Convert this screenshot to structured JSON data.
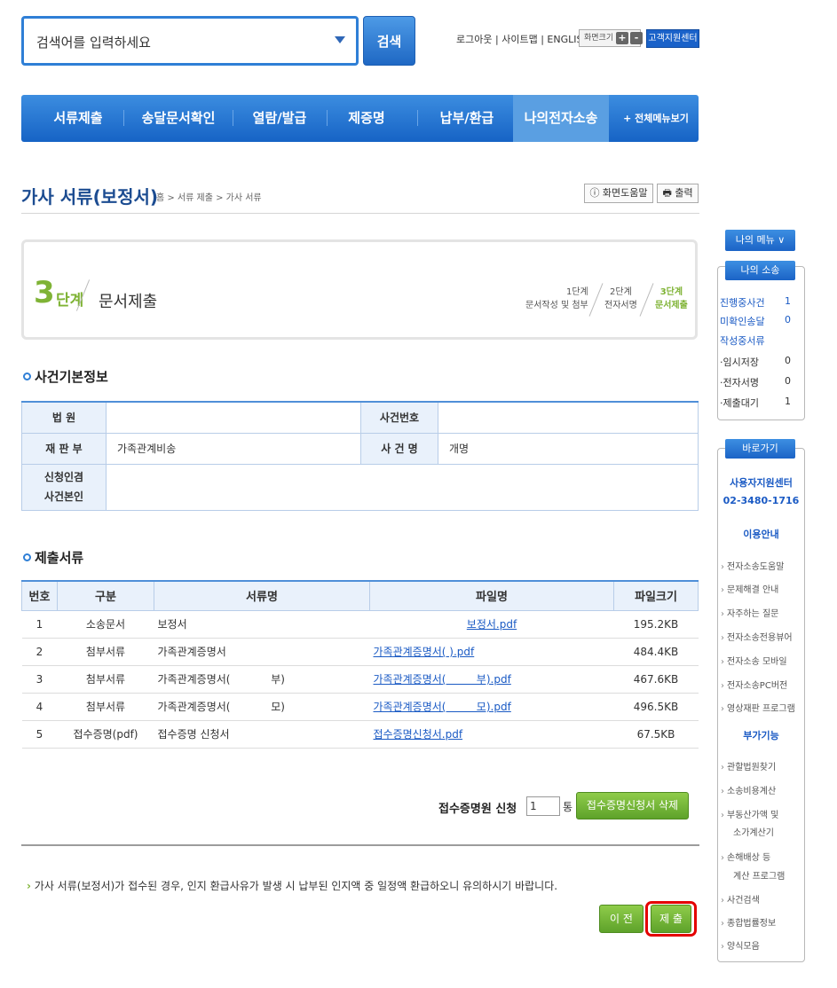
{
  "search": {
    "placeholder": "검색어를 입력하세요",
    "button": "검색"
  },
  "util": {
    "logout": "로그아웃",
    "sitemap": "사이트맵",
    "english": "ENGLISH",
    "fontsize": "화면크기",
    "plus": "+",
    "minus": "-",
    "support": "고객지원센터",
    "sep": "|"
  },
  "nav": {
    "items": [
      "서류제출",
      "송달문서확인",
      "열람/발급",
      "제증명",
      "납부/환급",
      "나의전자소송"
    ],
    "all": "+ 전체메뉴보기"
  },
  "page": {
    "title": "가사 서류(보정서)",
    "breadcrumb": "홈 > 서류 제출 > 가사 서류",
    "help": "ⓘ 화면도움말",
    "print": "🖶 출력"
  },
  "step": {
    "num": "3",
    "num_label": "단계",
    "title": "문서제출",
    "steps": [
      {
        "a": "1단계",
        "b": "문서작성 및 첨부"
      },
      {
        "a": "2단계",
        "b": "전자서명"
      },
      {
        "a": "3단계",
        "b": "문서제출"
      }
    ]
  },
  "case_info": {
    "title": "사건기본정보",
    "court_label": "법  원",
    "court_value": "",
    "case_no_label": "사건번호",
    "case_no_value": "",
    "dept_label": "재 판 부",
    "dept_value": "가족관계비송",
    "case_name_label": "사 건 명",
    "case_name_value": "개명",
    "apply_label_1": "신청인겸",
    "apply_label_2": "사건본인",
    "apply_value": ""
  },
  "docs": {
    "title": "제출서류",
    "headers": [
      "번호",
      "구분",
      "서류명",
      "파일명",
      "파일크기"
    ],
    "rows": [
      {
        "no": "1",
        "type": "소송문서",
        "name": "보정서",
        "file": "보정서.pdf",
        "size": "195.2KB"
      },
      {
        "no": "2",
        "type": "첨부서류",
        "name": "가족관계증명서",
        "file": "가족관계증명서(         ).pdf",
        "size": "484.4KB"
      },
      {
        "no": "3",
        "type": "첨부서류",
        "name": "가족관계증명서(            부)",
        "file": "가족관계증명서(         부).pdf",
        "size": "467.6KB"
      },
      {
        "no": "4",
        "type": "첨부서류",
        "name": "가족관계증명서(            모)",
        "file": "가족관계증명서(         모).pdf",
        "size": "496.5KB"
      },
      {
        "no": "5",
        "type": "접수증명(pdf)",
        "name": "접수증명 신청서",
        "file": "접수증명신청서.pdf",
        "size": "67.5KB"
      }
    ]
  },
  "apply": {
    "label": "접수증명원 신청",
    "count": "1",
    "unit": "통",
    "delete": "접수증명신청서 삭제"
  },
  "notice": {
    "arrow": "›",
    "text": "가사 서류(보정서)가 접수된 경우, 인지 환급사유가 발생 시 납부된 인지액 중 일정액 환급하오니 유의하시기 바랍니다."
  },
  "actions": {
    "prev": "이 전",
    "submit": "제 출"
  },
  "sidebar": {
    "my_menu": "나의 메뉴 ∨",
    "my_case": "나의 소송",
    "counts": [
      {
        "label": "진행중사건",
        "n": "1"
      },
      {
        "label": "미확인송달",
        "n": "0"
      },
      {
        "label": "작성중서류",
        "n": ""
      },
      {
        "label": "·임시저장",
        "n": "0"
      },
      {
        "label": "·전자서명",
        "n": "0"
      },
      {
        "label": "·제출대기",
        "n": "1"
      }
    ],
    "shortcut": "바로가기",
    "center": "사용자지원센터",
    "phone": "02-3480-1716",
    "guide": "이용안내",
    "guide_links": [
      "전자소송도움말",
      "문제해결 안내",
      "자주하는 질문",
      "전자소송전용뷰어",
      "전자소송 모바일",
      "전자소송PC버전",
      "영상재판 프로그램"
    ],
    "extra": "부가기능",
    "extra_links": [
      "관할법원찾기",
      "소송비용계산",
      "부동산가액 및",
      "소가계산기",
      "손해배상 등",
      "계산 프로그램",
      "사건검색",
      "종합법률정보",
      "양식모음"
    ]
  }
}
